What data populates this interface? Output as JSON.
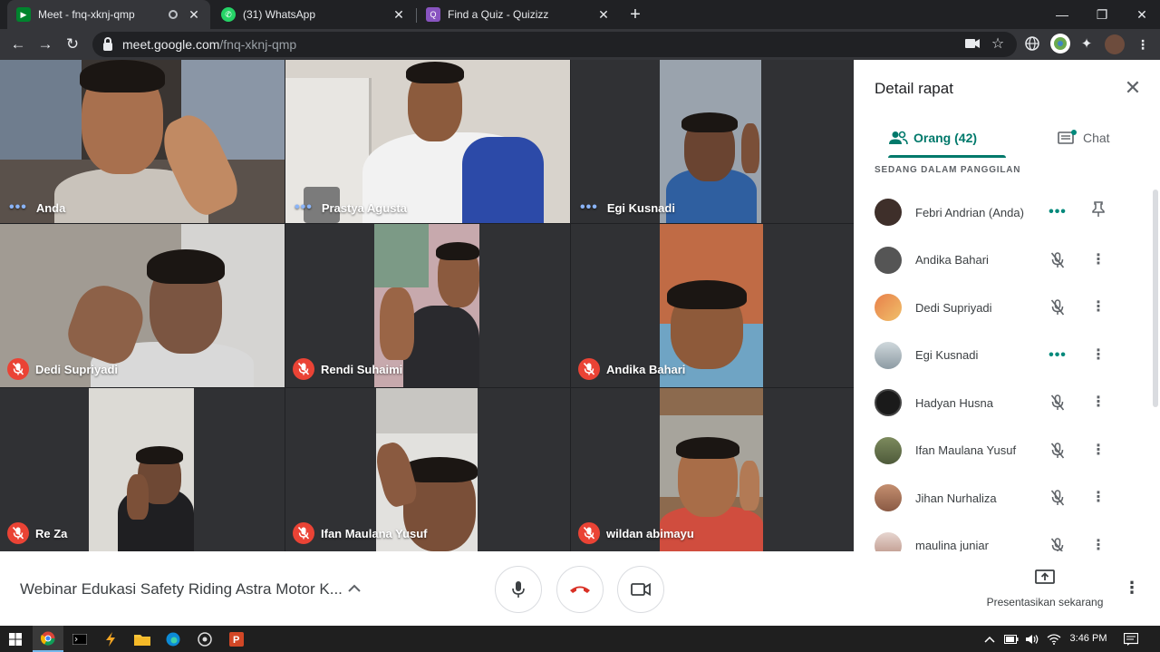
{
  "browser": {
    "tabs": [
      {
        "title": "Meet - fnq-xknj-qmp",
        "active": true
      },
      {
        "title": "(31) WhatsApp",
        "active": false
      },
      {
        "title": "Find a Quiz - Quizizz",
        "active": false
      }
    ],
    "url_host": "meet.google.com",
    "url_path": "/fnq-xknj-qmp"
  },
  "tiles": [
    {
      "name": "Anda",
      "state": "talking"
    },
    {
      "name": "Prastya Agusta",
      "state": "talking"
    },
    {
      "name": "Egi Kusnadi",
      "state": "talking"
    },
    {
      "name": "Dedi Supriyadi",
      "state": "muted"
    },
    {
      "name": "Rendi Suhaimi",
      "state": "muted"
    },
    {
      "name": "Andika Bahari",
      "state": "muted"
    },
    {
      "name": "Re Za",
      "state": "muted"
    },
    {
      "name": "Ifan Maulana Yusuf",
      "state": "muted"
    },
    {
      "name": "wildan abimayu",
      "state": "muted"
    }
  ],
  "panel": {
    "title": "Detail rapat",
    "tab_people": "Orang (42)",
    "tab_chat": "Chat",
    "section_label": "SEDANG DALAM PANGGILAN",
    "participants": [
      {
        "name": "Febri Andrian (Anda)",
        "status": "talking",
        "action": "pin-icon"
      },
      {
        "name": "Andika Bahari",
        "status": "muted",
        "action": "more-icon"
      },
      {
        "name": "Dedi Supriyadi",
        "status": "muted",
        "action": "more-icon"
      },
      {
        "name": "Egi Kusnadi",
        "status": "talking",
        "action": "more-icon"
      },
      {
        "name": "Hadyan Husna",
        "status": "muted",
        "action": "more-icon"
      },
      {
        "name": "Ifan Maulana Yusuf",
        "status": "muted",
        "action": "more-icon"
      },
      {
        "name": "Jihan Nurhaliza",
        "status": "muted",
        "action": "more-icon"
      },
      {
        "name": "maulina juniar",
        "status": "muted",
        "action": "more-icon"
      }
    ]
  },
  "callbar": {
    "meeting_title": "Webinar Edukasi Safety Riding Astra Motor K...",
    "present_label": "Presentasikan sekarang"
  },
  "taskbar": {
    "time": "3:46 PM"
  },
  "colors": {
    "accent_teal": "#00796b",
    "mute_red": "#ea4335",
    "hangup_red": "#d93025"
  }
}
